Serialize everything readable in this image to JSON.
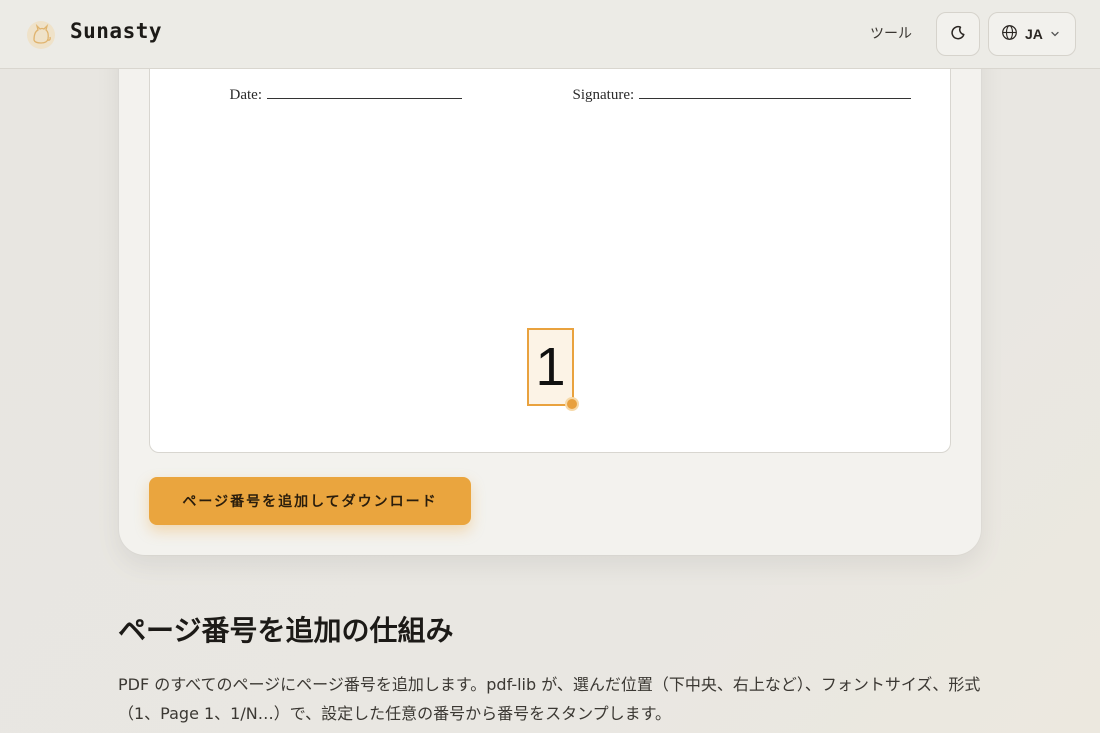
{
  "header": {
    "brand": "Sunasty",
    "logo_icon": "cat-logo-icon",
    "nav_tools_label": "ツール",
    "theme_icon": "moon-icon",
    "lang_icon": "globe-icon",
    "lang_label": "JA",
    "lang_chevron_icon": "chevron-down-icon"
  },
  "preview": {
    "date_label": "Date:",
    "signature_label": "Signature:",
    "page_number_stamp": "1"
  },
  "actions": {
    "download_label": "ページ番号を追加してダウンロード"
  },
  "section": {
    "title": "ページ番号を追加の仕組み",
    "body": "PDF のすべてのページにページ番号を追加します。pdf-lib が、選んだ位置（下中央、右上など）、フォントサイズ、形式（1、Page 1、1/N…）で、設定した任意の番号から番号をスタンプします。"
  },
  "colors": {
    "accent": "#eaa53e",
    "background": "#e9e7e2",
    "card": "#f3f2ee"
  }
}
